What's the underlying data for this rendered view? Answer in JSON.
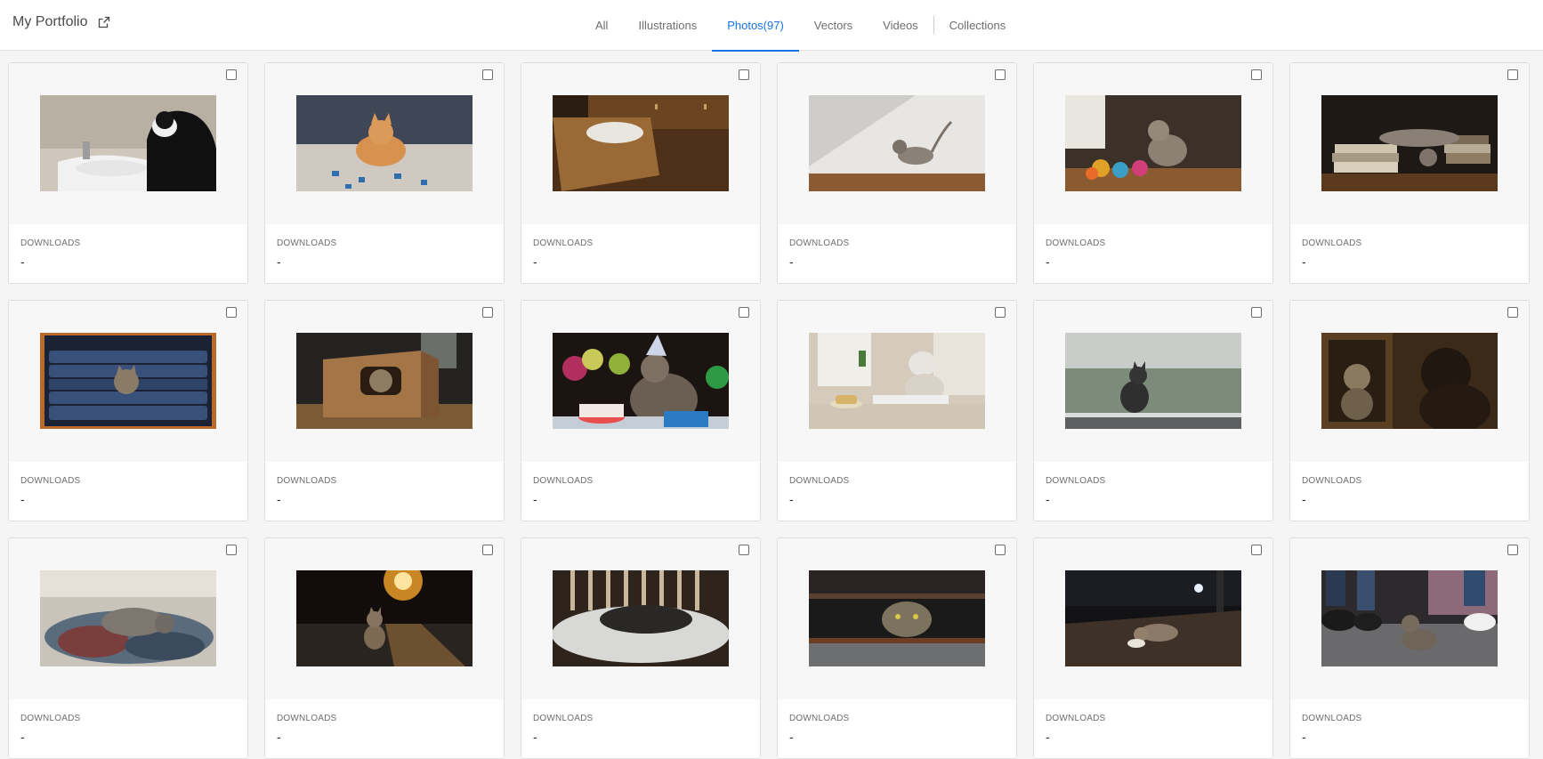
{
  "header": {
    "title": "My Portfolio",
    "external_icon": "external-link-icon"
  },
  "tabs": [
    {
      "label": "All",
      "active": false
    },
    {
      "label": "Illustrations",
      "active": false
    },
    {
      "label": "Photos(97)",
      "active": true
    },
    {
      "label": "Vectors",
      "active": false
    },
    {
      "label": "Videos",
      "active": false
    },
    {
      "label": "Collections",
      "active": false
    }
  ],
  "colors": {
    "accent": "#1473e6",
    "card_bg": "#ffffff",
    "thumb_area_bg": "#f7f7f7",
    "page_bg": "#f5f5f5"
  },
  "cards": [
    {
      "photo": "cat-by-bathroom-sink",
      "downloads_label": "DOWNLOADS",
      "downloads": "-"
    },
    {
      "photo": "kitten-with-puzzle-pieces",
      "downloads_label": "DOWNLOADS",
      "downloads": "-"
    },
    {
      "photo": "cat-sleeping-in-drawer",
      "downloads_label": "DOWNLOADS",
      "downloads": "-"
    },
    {
      "photo": "kitten-walking-in-sunlight",
      "downloads_label": "DOWNLOADS",
      "downloads": "-"
    },
    {
      "photo": "kitten-with-yarn-balls",
      "downloads_label": "DOWNLOADS",
      "downloads": "-"
    },
    {
      "photo": "cat-on-books",
      "downloads_label": "DOWNLOADS",
      "downloads": "-"
    },
    {
      "photo": "kitten-in-jeans-shelf",
      "downloads_label": "DOWNLOADS",
      "downloads": "-"
    },
    {
      "photo": "cat-in-cardboard-box",
      "downloads_label": "DOWNLOADS",
      "downloads": "-"
    },
    {
      "photo": "cat-birthday-party",
      "downloads_label": "DOWNLOADS",
      "downloads": "-"
    },
    {
      "photo": "cat-with-teacup",
      "downloads_label": "DOWNLOADS",
      "downloads": "-"
    },
    {
      "photo": "cat-at-rainy-window",
      "downloads_label": "DOWNLOADS",
      "downloads": "-"
    },
    {
      "photo": "cat-mirror-reflection",
      "downloads_label": "DOWNLOADS",
      "downloads": "-"
    },
    {
      "photo": "cat-sleeping-on-clothes",
      "downloads_label": "DOWNLOADS",
      "downloads": "-"
    },
    {
      "photo": "kitten-on-street-at-sunset",
      "downloads_label": "DOWNLOADS",
      "downloads": "-"
    },
    {
      "photo": "cat-sleeping-in-bed",
      "downloads_label": "DOWNLOADS",
      "downloads": "-"
    },
    {
      "photo": "cat-under-grate",
      "downloads_label": "DOWNLOADS",
      "downloads": "-"
    },
    {
      "photo": "cat-eating-on-night-street",
      "downloads_label": "DOWNLOADS",
      "downloads": "-"
    },
    {
      "photo": "kitten-among-feet",
      "downloads_label": "DOWNLOADS",
      "downloads": "-"
    }
  ]
}
